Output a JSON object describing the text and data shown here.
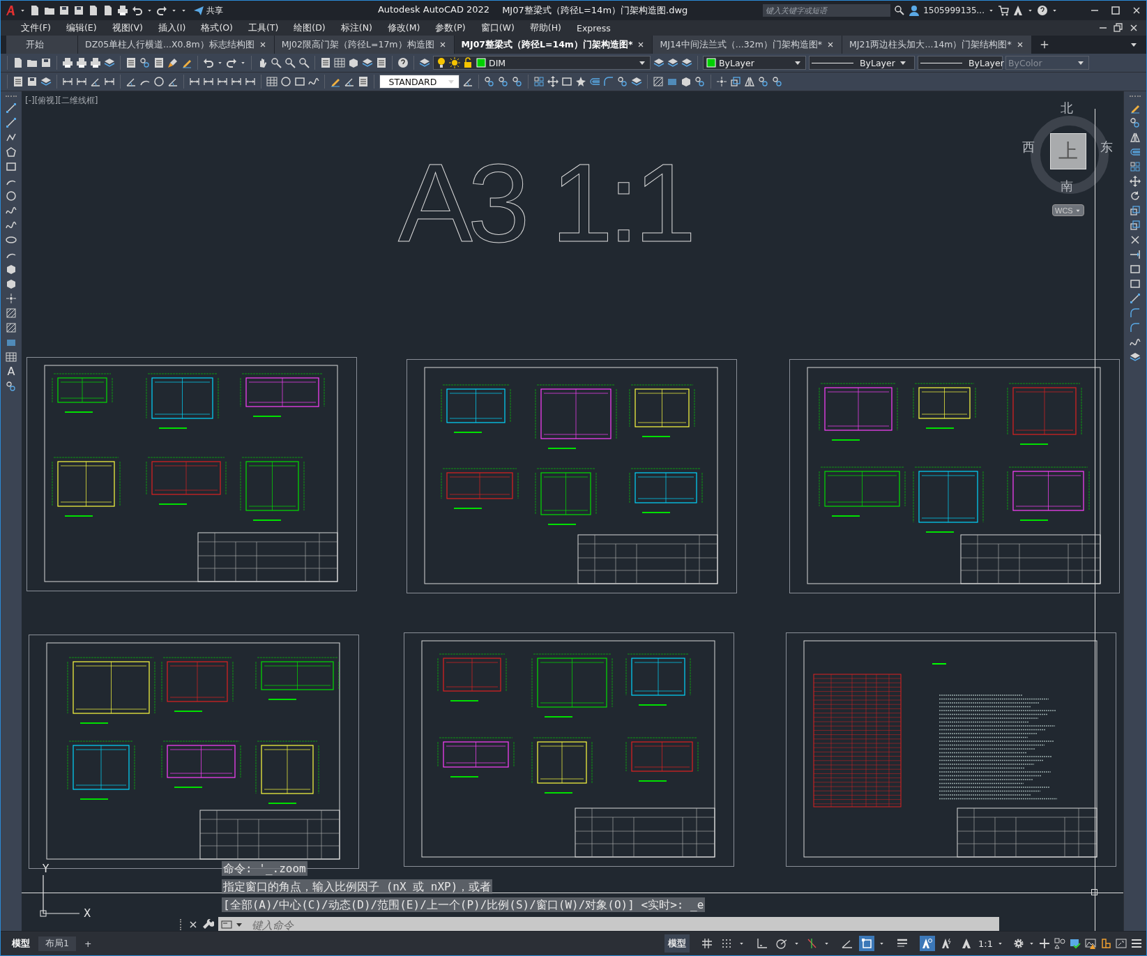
{
  "title_bar": {
    "share": "共享",
    "app": "Autodesk AutoCAD 2022",
    "file": "MJ07整梁式（跨径L=14m）门架构造图.dwg",
    "search": {
      "placeholder": "键入关键字或短语"
    },
    "user": "1505999135..."
  },
  "menu_bar": [
    "文件(F)",
    "编辑(E)",
    "视图(V)",
    "插入(I)",
    "格式(O)",
    "工具(T)",
    "绘图(D)",
    "标注(N)",
    "修改(M)",
    "参数(P)",
    "窗口(W)",
    "帮助(H)",
    "Express"
  ],
  "doc_tabs": [
    {
      "label": "开始",
      "selected": false,
      "closable": false
    },
    {
      "label": "DZ05单柱人行横道...X0.8m）标志结构图",
      "selected": false,
      "closable": true
    },
    {
      "label": "MJ02限高门架（跨径L=17m）构造图",
      "selected": false,
      "closable": true
    },
    {
      "label": "MJ07整梁式（跨径L=14m）门架构造图*",
      "selected": true,
      "closable": true
    },
    {
      "label": "MJ14中间法兰式（...32m）门架构造图*",
      "selected": false,
      "closable": true
    },
    {
      "label": "MJ21两边柱头加大...14m）门架结构图*",
      "selected": false,
      "closable": true
    }
  ],
  "properties_toolbar": {
    "layer": "DIM",
    "color_control": "ByLayer",
    "linetype": "ByLayer",
    "lineweight": "ByLayer",
    "plot_style": {
      "value": "ByColor",
      "disabled": true
    }
  },
  "style_toolbar": {
    "text_style": "STANDARD"
  },
  "left_toolbar": {
    "text_tool": "A"
  },
  "viewport": {
    "label": "[-][俯视][二维线框]",
    "big_text": "A3 1:1",
    "viewcube": {
      "north": "北",
      "east": "东",
      "south": "南",
      "west": "西",
      "face": "上",
      "ucs": "WCS"
    },
    "ucs_axes": {
      "x": "X",
      "y": "Y"
    }
  },
  "command_history": [
    "命令: '_.zoom",
    "指定窗口的角点，输入比例因子 (nX 或 nXP)，或者",
    "[全部(A)/中心(C)/动态(D)/范围(E)/上一个(P)/比例(S)/窗口(W)/对象(O)] <实时>: _e"
  ],
  "command_input": {
    "placeholder": "键入命令"
  },
  "layout_tabs": [
    {
      "label": "模型",
      "selected": true
    },
    {
      "label": "布局1",
      "selected": false
    }
  ],
  "new_layout": "+",
  "status_bar": {
    "space": "模型",
    "toggles": [
      {
        "kind": "grid",
        "on": false
      },
      {
        "kind": "snap",
        "on": false
      },
      {
        "kind": "ortho",
        "on": false
      },
      {
        "kind": "polar",
        "on": false
      },
      {
        "kind": "isodraft",
        "on": false
      },
      {
        "kind": "angle",
        "on": false
      },
      {
        "kind": "osnap",
        "on": true
      },
      {
        "kind": "lineweight",
        "on": false
      },
      {
        "kind": "annovis",
        "on": true
      },
      {
        "kind": "autoscale",
        "on": false
      },
      {
        "kind": "annoscale",
        "on": false
      }
    ],
    "scale": "1:1"
  }
}
